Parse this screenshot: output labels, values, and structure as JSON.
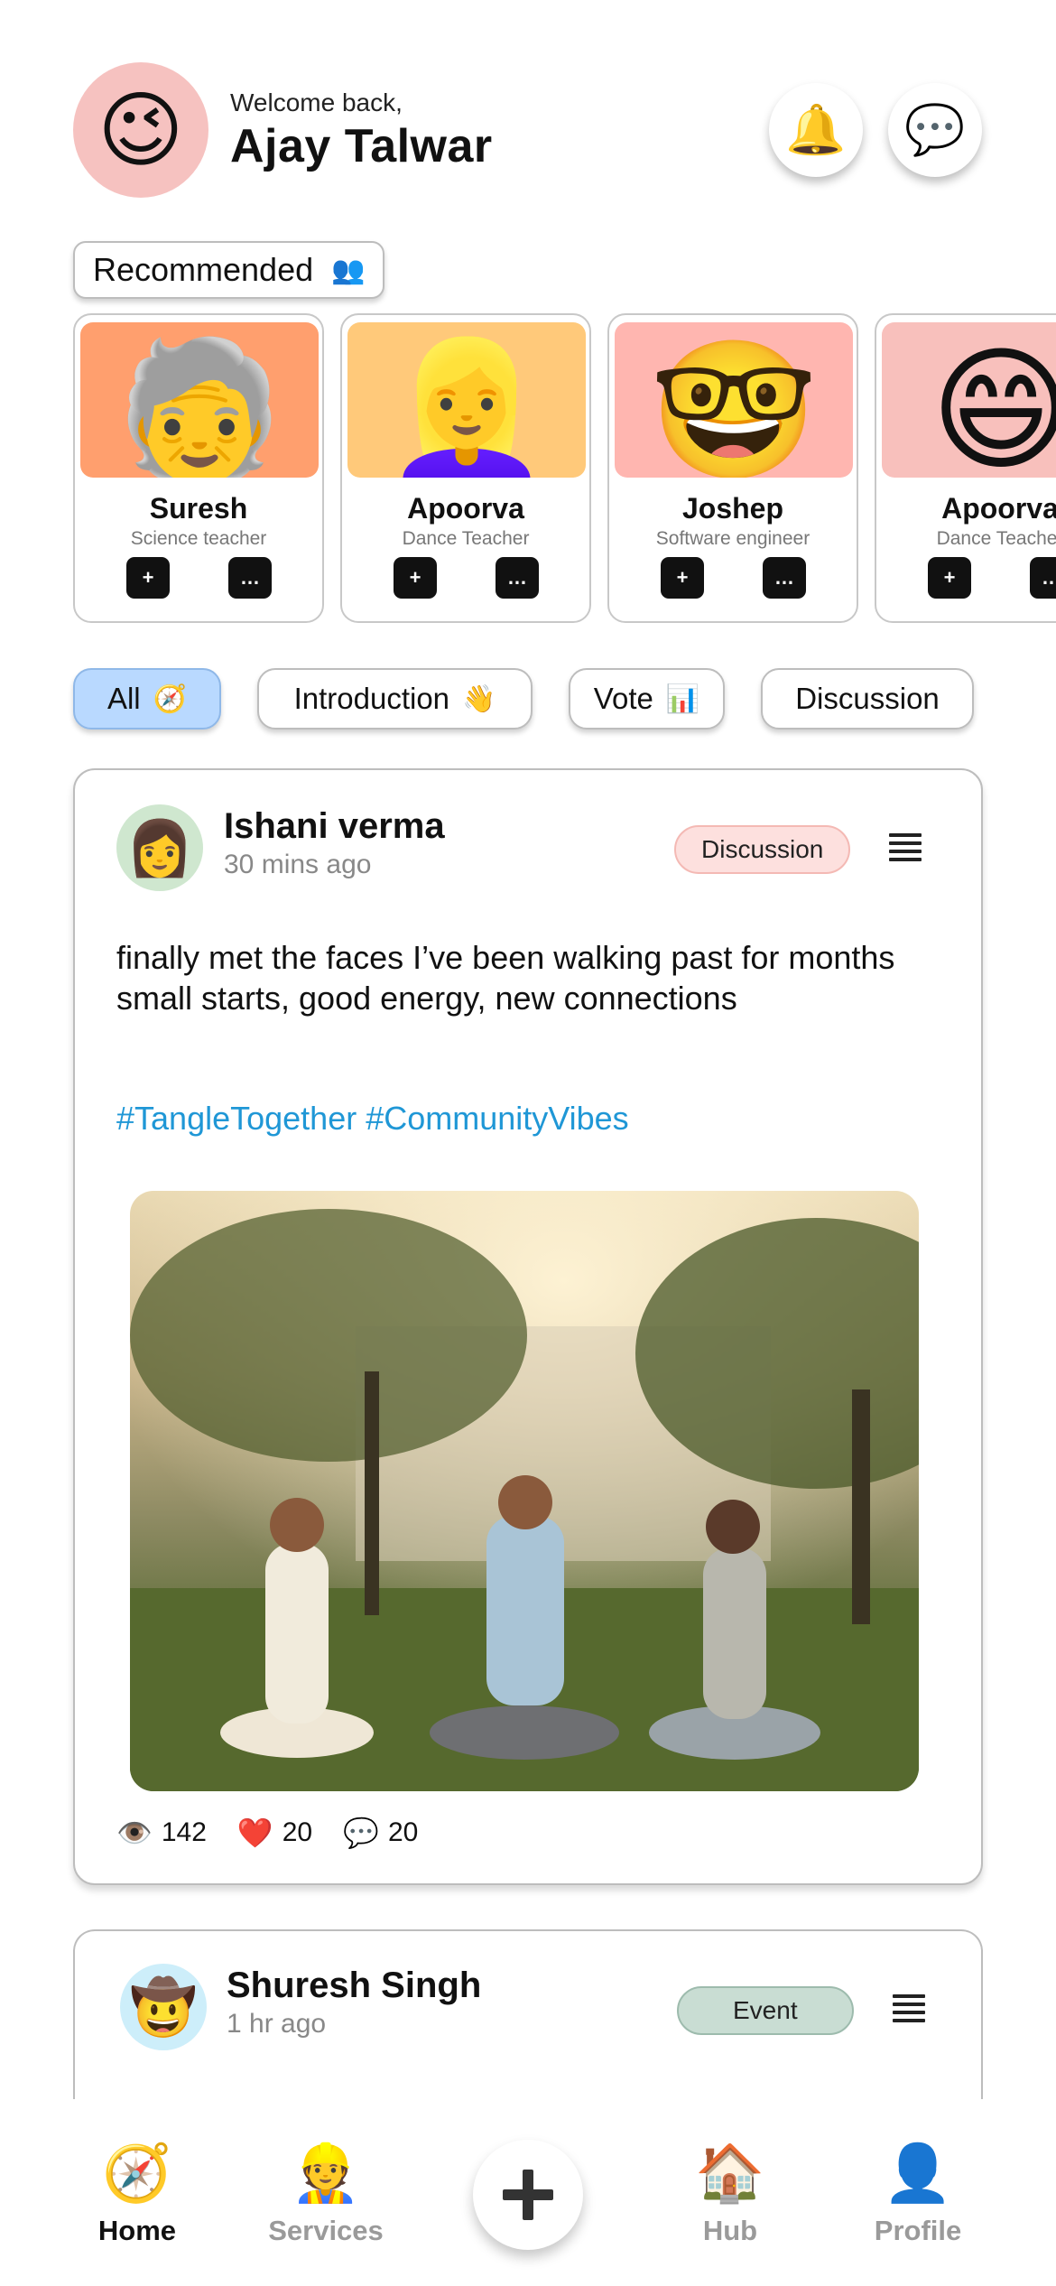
{
  "header": {
    "welcome": "Welcome back,",
    "username": "Ajay Talwar",
    "avatar_icon": "😉",
    "bell_icon": "🔔",
    "chat_icon": "💬"
  },
  "recommended": {
    "label": "Recommended",
    "icon": "👥",
    "people": [
      {
        "name": "Suresh",
        "role": "Science teacher",
        "emoji": "🧓",
        "bg": "#ff9f6e"
      },
      {
        "name": "Apoorva",
        "role": "Dance Teacher",
        "emoji": "👱‍♀️",
        "bg": "#ffc97a"
      },
      {
        "name": "Joshep",
        "role": "Software engineer",
        "emoji": "🤓",
        "bg": "#ffb6b0"
      },
      {
        "name": "Apoorva",
        "role": "Dance Teacher",
        "emoji": "😄",
        "bg": "#f8c0bc"
      }
    ],
    "add_icon": "+",
    "msg_icon": "…"
  },
  "filters": [
    {
      "label": "All",
      "icon": "🧭"
    },
    {
      "label": "Introduction",
      "icon": "👋"
    },
    {
      "label": "Vote",
      "icon": "📊"
    },
    {
      "label": "Discussion",
      "icon": ""
    }
  ],
  "post": {
    "author": "Ishani verma",
    "time": "30 mins ago",
    "avatar_icon": "👩",
    "tag": "Discussion",
    "text_line1": "finally met the faces I’ve been walking past for months",
    "text_line2": "small starts, good energy, new connections",
    "hashtags": "#TangleTogether #CommunityVibes",
    "views": "142",
    "likes": "20",
    "comments": "20",
    "views_icon": "👁️",
    "likes_icon": "❤️",
    "comments_icon": "💬"
  },
  "post2": {
    "author": "Shuresh Singh",
    "time": "1 hr ago",
    "avatar_icon": "🤠",
    "tag": "Event"
  },
  "nav": {
    "home": {
      "label": "Home",
      "icon": "🧭"
    },
    "services": {
      "label": "Services",
      "icon": "👷"
    },
    "hub": {
      "label": "Hub",
      "icon": "🏠"
    },
    "profile": {
      "label": "Profile",
      "icon": "👤"
    }
  }
}
